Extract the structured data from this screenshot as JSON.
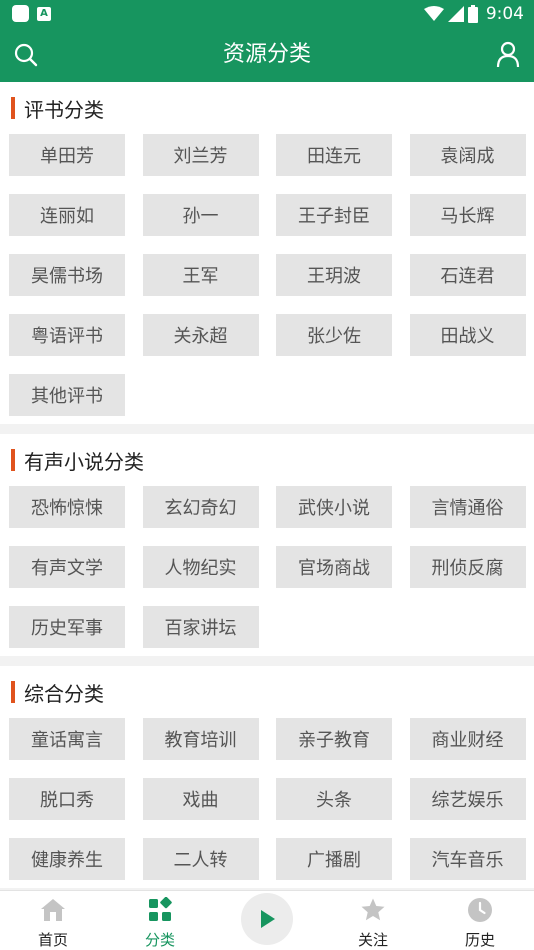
{
  "status_bar": {
    "time": "9:04",
    "battery": "8"
  },
  "header": {
    "title": "资源分类"
  },
  "sections": [
    {
      "title": "评书分类",
      "tags": [
        "单田芳",
        "刘兰芳",
        "田连元",
        "袁阔成",
        "连丽如",
        "孙一",
        "王子封臣",
        "马长辉",
        "昊儒书场",
        "王军",
        "王玥波",
        "石连君",
        "粤语评书",
        "关永超",
        "张少佐",
        "田战义",
        "其他评书"
      ]
    },
    {
      "title": "有声小说分类",
      "tags": [
        "恐怖惊悚",
        "玄幻奇幻",
        "武侠小说",
        "言情通俗",
        "有声文学",
        "人物纪实",
        "官场商战",
        "刑侦反腐",
        "历史军事",
        "百家讲坛"
      ]
    },
    {
      "title": "综合分类",
      "tags": [
        "童话寓言",
        "教育培训",
        "亲子教育",
        "商业财经",
        "脱口秀",
        "戏曲",
        "头条",
        "综艺娱乐",
        "健康养生",
        "二人转",
        "广播剧",
        "汽车音乐"
      ]
    }
  ],
  "bottom_nav": {
    "home": "首页",
    "category": "分类",
    "follow": "关注",
    "history": "历史"
  },
  "colors": {
    "primary": "#17955f",
    "accent_bar": "#e0531d",
    "tag_bg": "#e4e4e4"
  }
}
